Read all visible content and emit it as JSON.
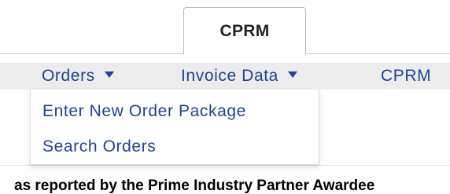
{
  "tabs": {
    "active_label": "CPRM"
  },
  "menubar": {
    "items": [
      {
        "label": "Orders",
        "has_caret": true
      },
      {
        "label": "Invoice Data",
        "has_caret": true
      },
      {
        "label": "CPRM",
        "has_caret": false
      }
    ]
  },
  "dropdown": {
    "items": [
      {
        "label": "Enter New Order Package"
      },
      {
        "label": "Search Orders"
      }
    ]
  },
  "content": {
    "caption": "as reported by the Prime Industry Partner Awardee"
  },
  "colors": {
    "link": "#21419a",
    "menubar_bg": "#ececec"
  }
}
